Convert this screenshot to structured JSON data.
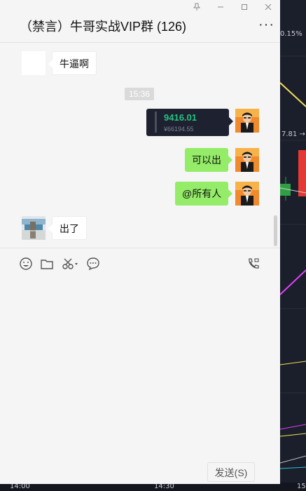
{
  "window": {
    "title": "（禁言）牛哥实战VIP群 (126)",
    "controls": [
      "pin-icon",
      "minimize-icon",
      "maximize-icon",
      "close-icon"
    ],
    "more_label": "···"
  },
  "messages": {
    "msg1": {
      "side": "left",
      "text": "牛逼啊"
    },
    "timestamp": "15:36",
    "card": {
      "price": "9416.01",
      "sub": "¥66194.55"
    },
    "msg2": {
      "side": "right",
      "text": "可以出"
    },
    "msg3": {
      "side": "right",
      "text": "@所有人"
    },
    "msg4": {
      "side": "left",
      "text": "出了"
    }
  },
  "toolbar": {
    "icons": [
      "emoji-icon",
      "folder-icon",
      "scissors-icon",
      "chat-bubble-icon",
      "video-call-icon"
    ]
  },
  "send_label": "发送(S)",
  "background": {
    "percent_label": "0.15%",
    "price_label": "7.81 →",
    "time_labels": [
      "14:00",
      "14:30",
      "15"
    ],
    "colors": {
      "up": "#e53935",
      "down": "#26c281",
      "line1": "#f1e05a",
      "line2": "#e040fb"
    }
  }
}
